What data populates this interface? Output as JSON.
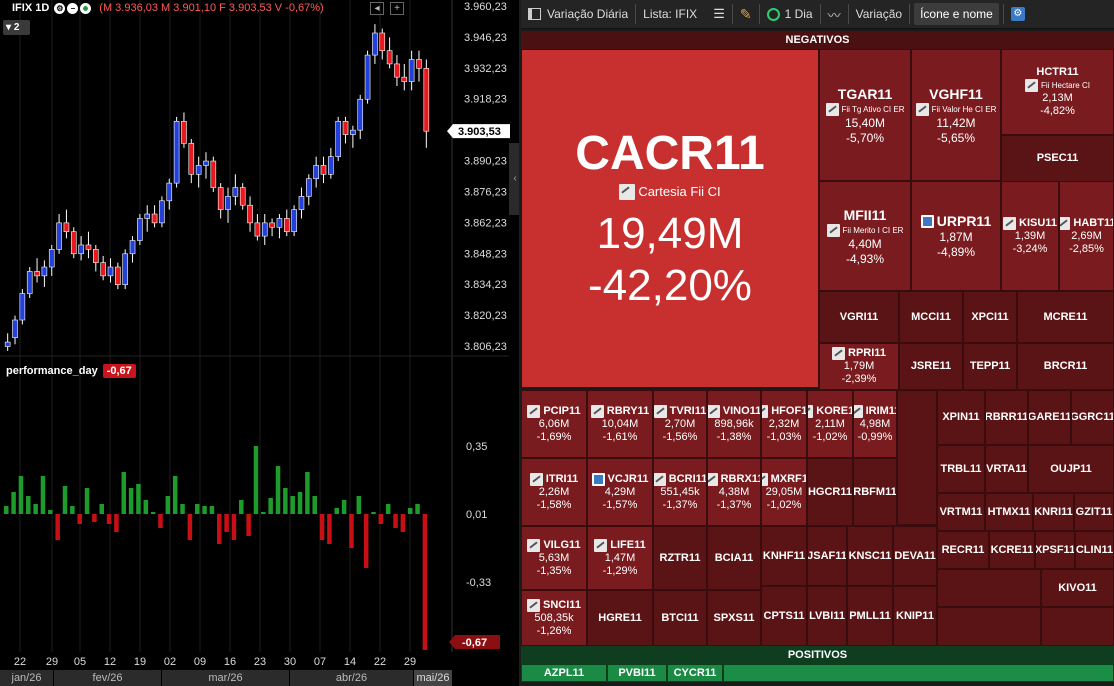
{
  "chart_header": {
    "symbol": "IFIX 1D",
    "quote": "(M 3.936,03 M 3.901,10 F 3.903,53 V -0,67%)",
    "badge": "2",
    "icons": [
      "settings-icon",
      "hide-icon",
      "status-dot-icon"
    ]
  },
  "price_axis": {
    "ticks": [
      "3.960,23",
      "3.946,23",
      "3.932,23",
      "3.918,23",
      "3.904,23",
      "3.890,23",
      "3.876,23",
      "3.862,23",
      "3.848,23",
      "3.834,23",
      "3.820,23",
      "3.806,23"
    ],
    "current": "3.903,53"
  },
  "indicator": {
    "name": "performance_day",
    "value": "-0,67",
    "ticks": [
      "0,35",
      "0,01",
      "-0,33"
    ],
    "current": "-0,67"
  },
  "x_axis": {
    "days": [
      "22",
      "29",
      "05",
      "12",
      "19",
      "02",
      "09",
      "16",
      "23",
      "30",
      "07",
      "14",
      "22",
      "29"
    ],
    "months": [
      "jan/26",
      "fev/26",
      "mar/26",
      "abr/26",
      "mai/26"
    ]
  },
  "chart_data": {
    "type": "candlestick",
    "ylim": [
      3800,
      3962
    ],
    "current_price": 3903.53,
    "candles": [
      [
        3806,
        3812,
        3804,
        3808
      ],
      [
        3810,
        3820,
        3807,
        3818
      ],
      [
        3818,
        3832,
        3816,
        3830
      ],
      [
        3830,
        3842,
        3828,
        3840
      ],
      [
        3840,
        3846,
        3835,
        3838
      ],
      [
        3838,
        3845,
        3833,
        3842
      ],
      [
        3842,
        3852,
        3838,
        3850
      ],
      [
        3850,
        3866,
        3848,
        3862
      ],
      [
        3862,
        3868,
        3855,
        3858
      ],
      [
        3858,
        3860,
        3846,
        3848
      ],
      [
        3848,
        3856,
        3845,
        3852
      ],
      [
        3852,
        3858,
        3846,
        3850
      ],
      [
        3850,
        3852,
        3840,
        3844
      ],
      [
        3844,
        3847,
        3836,
        3838
      ],
      [
        3838,
        3846,
        3835,
        3842
      ],
      [
        3842,
        3844,
        3832,
        3834
      ],
      [
        3834,
        3850,
        3832,
        3848
      ],
      [
        3848,
        3856,
        3844,
        3854
      ],
      [
        3854,
        3866,
        3852,
        3864
      ],
      [
        3864,
        3870,
        3858,
        3866
      ],
      [
        3866,
        3870,
        3860,
        3862
      ],
      [
        3862,
        3874,
        3860,
        3872
      ],
      [
        3872,
        3882,
        3868,
        3880
      ],
      [
        3880,
        3910,
        3878,
        3908
      ],
      [
        3908,
        3912,
        3896,
        3898
      ],
      [
        3898,
        3900,
        3880,
        3884
      ],
      [
        3884,
        3892,
        3878,
        3888
      ],
      [
        3888,
        3894,
        3882,
        3890
      ],
      [
        3890,
        3892,
        3876,
        3878
      ],
      [
        3878,
        3880,
        3864,
        3868
      ],
      [
        3868,
        3878,
        3862,
        3874
      ],
      [
        3874,
        3884,
        3870,
        3878
      ],
      [
        3878,
        3880,
        3868,
        3870
      ],
      [
        3870,
        3874,
        3858,
        3862
      ],
      [
        3862,
        3866,
        3854,
        3856
      ],
      [
        3856,
        3866,
        3852,
        3862
      ],
      [
        3862,
        3864,
        3856,
        3860
      ],
      [
        3860,
        3866,
        3855,
        3864
      ],
      [
        3864,
        3868,
        3856,
        3858
      ],
      [
        3858,
        3870,
        3856,
        3868
      ],
      [
        3868,
        3878,
        3864,
        3874
      ],
      [
        3874,
        3884,
        3870,
        3882
      ],
      [
        3882,
        3892,
        3878,
        3888
      ],
      [
        3888,
        3892,
        3880,
        3884
      ],
      [
        3884,
        3896,
        3882,
        3892
      ],
      [
        3892,
        3910,
        3890,
        3908
      ],
      [
        3908,
        3910,
        3898,
        3902
      ],
      [
        3902,
        3906,
        3896,
        3904
      ],
      [
        3904,
        3920,
        3900,
        3918
      ],
      [
        3918,
        3940,
        3916,
        3938
      ],
      [
        3938,
        3952,
        3934,
        3948
      ],
      [
        3948,
        3950,
        3936,
        3940
      ],
      [
        3940,
        3946,
        3932,
        3934
      ],
      [
        3934,
        3938,
        3924,
        3928
      ],
      [
        3928,
        3934,
        3922,
        3926
      ],
      [
        3926,
        3940,
        3922,
        3936
      ],
      [
        3936,
        3940,
        3926,
        3932
      ],
      [
        3932,
        3936,
        3896,
        3903.53
      ]
    ],
    "performance_day": {
      "ylim": [
        -0.67,
        0.75
      ],
      "values": [
        0.05,
        0.12,
        0.2,
        0.1,
        0.06,
        0.2,
        0.03,
        -0.12,
        0.15,
        0.05,
        -0.04,
        0.14,
        -0.03,
        0.06,
        -0.04,
        -0.08,
        0.22,
        0.14,
        0.16,
        0.08,
        0.02,
        -0.06,
        0.1,
        0.2,
        0.06,
        -0.12,
        0.06,
        0.05,
        0.05,
        -0.14,
        -0.08,
        -0.12,
        0.08,
        -0.1,
        0.35,
        0.02,
        0.09,
        0.25,
        0.14,
        0.1,
        0.12,
        0.22,
        0.1,
        -0.12,
        -0.14,
        0.04,
        0.08,
        -0.16,
        0.1,
        -0.26,
        0.02,
        -0.04,
        0.06,
        -0.06,
        -0.08,
        0.04,
        0.06,
        -0.67
      ]
    }
  },
  "toolbar": {
    "variacao_diaria": "Variação Diária",
    "lista": "Lista: IFIX",
    "periodo": "1 Dia",
    "variacao": "Variação",
    "icone_nome": "Ícone e nome",
    "icons": [
      "chart-icon",
      "list-icon",
      "brush-icon",
      "clock-icon",
      "trend-icon",
      "settings-icon"
    ]
  },
  "sections": {
    "negativos": "NEGATIVOS",
    "positivos": "POSITIVOS"
  },
  "colors": {
    "red_big": "#c8302f",
    "red_mid": "#7a1c1f",
    "red_dark": "#5b1416",
    "green": "#1a8a45"
  },
  "tiles": {
    "CACR11": {
      "ticker": "CACR11",
      "name": "Cartesia Fii CI",
      "vol": "19,49M",
      "pct": "-42,20%"
    },
    "TGAR11": {
      "ticker": "TGAR11",
      "name": "Fii Tg Ativo CI ER",
      "vol": "15,40M",
      "pct": "-5,70%"
    },
    "VGHF11": {
      "ticker": "VGHF11",
      "name": "Fii Valor He CI ER",
      "vol": "11,42M",
      "pct": "-5,65%"
    },
    "HCTR11": {
      "ticker": "HCTR11",
      "name": "Fii Hectare CI",
      "vol": "2,13M",
      "pct": "-4,82%"
    },
    "PSEC11": {
      "ticker": "PSEC11"
    },
    "MFII11": {
      "ticker": "MFII11",
      "name": "Fii Merito I CI ER",
      "vol": "4,40M",
      "pct": "-4,93%"
    },
    "URPR11": {
      "ticker": "URPR11",
      "vol": "1,87M",
      "pct": "-4,89%"
    },
    "KISU11": {
      "ticker": "KISU11",
      "vol": "1,39M",
      "pct": "-3,24%"
    },
    "HABT11": {
      "ticker": "HABT11",
      "vol": "2,69M",
      "pct": "-2,85%"
    },
    "VGRI11": {
      "ticker": "VGRI11"
    },
    "MCCI11": {
      "ticker": "MCCI11"
    },
    "XPCI11": {
      "ticker": "XPCI11"
    },
    "MCRE11": {
      "ticker": "MCRE11"
    },
    "RPRI11": {
      "ticker": "RPRI11",
      "vol": "1,79M",
      "pct": "-2,39%"
    },
    "JSRE11": {
      "ticker": "JSRE11"
    },
    "TEPP11": {
      "ticker": "TEPP11"
    },
    "BRCR11": {
      "ticker": "BRCR11"
    },
    "PCIP11": {
      "ticker": "PCIP11",
      "vol": "6,06M",
      "pct": "-1,69%"
    },
    "RBRY11": {
      "ticker": "RBRY11",
      "vol": "10,04M",
      "pct": "-1,61%"
    },
    "TVRI11": {
      "ticker": "TVRI11",
      "vol": "2,70M",
      "pct": "-1,56%"
    },
    "VINO11": {
      "ticker": "VINO11",
      "vol": "898,96k",
      "pct": "-1,38%"
    },
    "HFOF11": {
      "ticker": "HFOF11",
      "vol": "2,32M",
      "pct": "-1,03%"
    },
    "KORE11": {
      "ticker": "KORE11",
      "vol": "2,11M",
      "pct": "-1,02%"
    },
    "IRIM11": {
      "ticker": "IRIM11",
      "vol": "4,98M",
      "pct": "-0,99%"
    },
    "XPIN11": {
      "ticker": "XPIN11"
    },
    "RBRR11": {
      "ticker": "RBRR11"
    },
    "GARE11": {
      "ticker": "GARE11"
    },
    "GGRC11": {
      "ticker": "GGRC11"
    },
    "ITRI11": {
      "ticker": "ITRI11",
      "vol": "2,26M",
      "pct": "-1,58%"
    },
    "VCJR11": {
      "ticker": "VCJR11",
      "vol": "4,29M",
      "pct": "-1,57%"
    },
    "BCRI11": {
      "ticker": "BCRI11",
      "vol": "551,45k",
      "pct": "-1,37%"
    },
    "RBRX11": {
      "ticker": "RBRX11",
      "vol": "4,38M",
      "pct": "-1,37%"
    },
    "MXRF11": {
      "ticker": "MXRF11",
      "vol": "29,05M",
      "pct": "-1,02%"
    },
    "HGCR11": {
      "ticker": "HGCR11"
    },
    "RBFM11": {
      "ticker": "RBFM11"
    },
    "TRBL11": {
      "ticker": "TRBL11"
    },
    "VRTA11": {
      "ticker": "VRTA11"
    },
    "OUJP11": {
      "ticker": "OUJP11"
    },
    "VRTM11": {
      "ticker": "VRTM11"
    },
    "HTMX11": {
      "ticker": "HTMX11"
    },
    "KNRI11": {
      "ticker": "KNRI11"
    },
    "GZIT11": {
      "ticker": "GZIT11"
    },
    "VILG11": {
      "ticker": "VILG11",
      "vol": "5,63M",
      "pct": "-1,35%"
    },
    "LIFE11": {
      "ticker": "LIFE11",
      "vol": "1,47M",
      "pct": "-1,29%"
    },
    "RZTR11": {
      "ticker": "RZTR11"
    },
    "BCIA11": {
      "ticker": "BCIA11"
    },
    "KNHF11": {
      "ticker": "KNHF11"
    },
    "JSAF11": {
      "ticker": "JSAF11"
    },
    "KNSC11": {
      "ticker": "KNSC11"
    },
    "DEVA11": {
      "ticker": "DEVA11"
    },
    "RECR11": {
      "ticker": "RECR11"
    },
    "KCRE11": {
      "ticker": "KCRE11"
    },
    "XPSF11": {
      "ticker": "XPSF11"
    },
    "CLIN11": {
      "ticker": "CLIN11"
    },
    "KIVO11": {
      "ticker": "KIVO11"
    },
    "SNCI11": {
      "ticker": "SNCI11",
      "vol": "508,35k",
      "pct": "-1,26%"
    },
    "HGRE11": {
      "ticker": "HGRE11"
    },
    "BTCI11": {
      "ticker": "BTCI11"
    },
    "SPXS11": {
      "ticker": "SPXS11"
    },
    "CPTS11": {
      "ticker": "CPTS11"
    },
    "LVBI11": {
      "ticker": "LVBI11"
    },
    "PMLL11": {
      "ticker": "PMLL11"
    },
    "KNIP11": {
      "ticker": "KNIP11"
    },
    "AZPL11": {
      "ticker": "AZPL11"
    },
    "PVBI11": {
      "ticker": "PVBI11"
    },
    "CYCR11": {
      "ticker": "CYCR11"
    }
  }
}
